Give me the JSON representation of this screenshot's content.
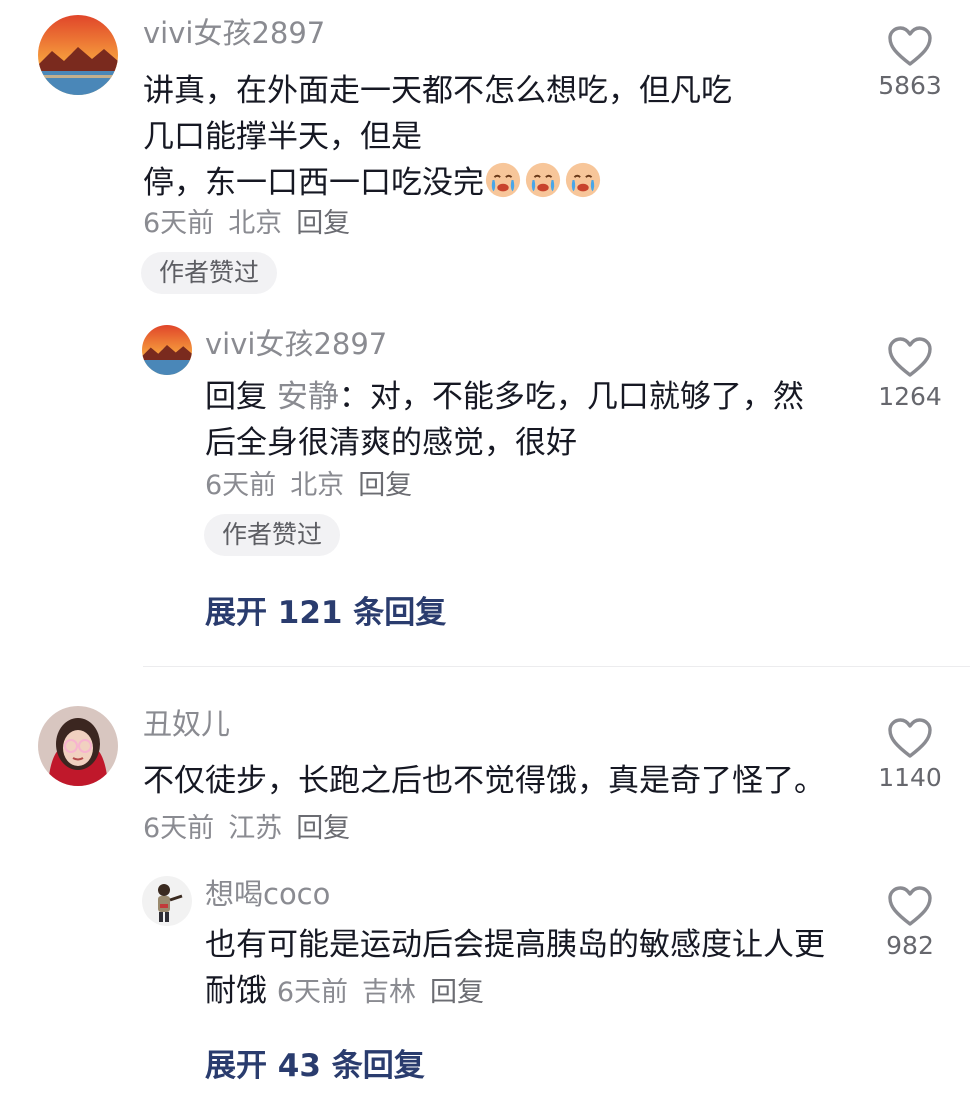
{
  "comments": [
    {
      "username": "vivi女孩2897",
      "text_parts": [
        "讲真，在外面走一天都不怎么想吃，但凡吃",
        "几口能撑半天，但是",
        "停，东一口西一口吃没完"
      ],
      "emoji_icon": "crying-face-emoji",
      "time": "6天前",
      "location": "北京",
      "reply_label": "回复",
      "badge": "作者赞过",
      "likes": "5863",
      "replies": [
        {
          "username": "vivi女孩2897",
          "reply_prefix": "回复",
          "mention": "安静",
          "text": "：对，不能多吃，几口就够了，然后全身很清爽的感觉，很好",
          "time": "6天前",
          "location": "北京",
          "reply_label": "回复",
          "badge": "作者赞过",
          "likes": "1264"
        }
      ],
      "expand_label": "展开 121 条回复"
    },
    {
      "username": "丑奴儿",
      "text": "不仅徒步，长跑之后也不觉得饿，真是奇了怪了。",
      "time": "6天前",
      "location": "江苏",
      "reply_label": "回复",
      "likes": "1140",
      "replies": [
        {
          "username": "想喝coco",
          "text": "也有可能是运动后会提高胰岛的敏感度让人更耐饿",
          "time": "6天前",
          "location": "吉林",
          "reply_label": "回复",
          "likes": "982"
        }
      ],
      "expand_label": "展开 43 条回复"
    }
  ],
  "icons": {
    "like": "heart-outline-icon"
  },
  "colors": {
    "text": "#161823",
    "secondary": "#8a8b91",
    "link": "#2a3c6e",
    "badge_bg": "#f2f2f4"
  }
}
